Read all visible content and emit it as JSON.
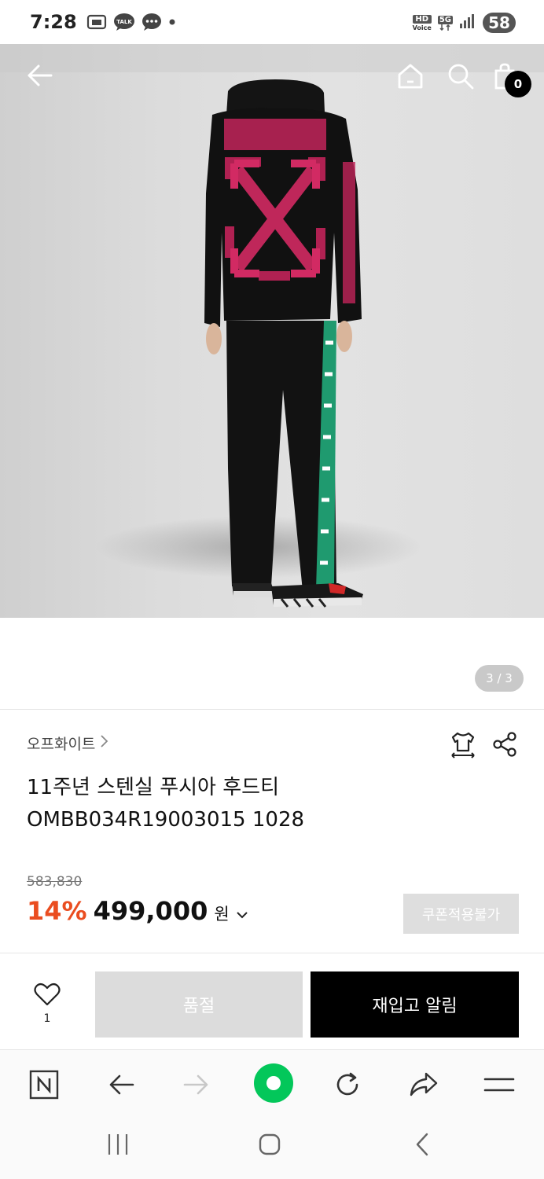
{
  "status_bar": {
    "time": "7:28",
    "hd_top": "HD",
    "hd_bottom": "Voice",
    "network": "5G",
    "battery": "58"
  },
  "header": {
    "cart_count": "0"
  },
  "gallery": {
    "counter": "3 / 3"
  },
  "product": {
    "brand": "오프화이트",
    "title_line1": "11주년 스텐실 푸시아 후드티",
    "title_line2": "OMBB034R19003015 1028",
    "original_price": "583,830",
    "discount": "14%",
    "price": "499,000",
    "currency": "원",
    "coupon_label": "쿠폰적용불가"
  },
  "actions": {
    "wish_count": "1",
    "soldout_label": "품절",
    "restock_label": "재입고 알림"
  },
  "colors": {
    "discount": "#ea4d20",
    "primary_button": "#000000",
    "disabled_button": "#dcdcdc",
    "browser_accent": "#03c75a"
  },
  "icons": {
    "back": "arrow-left-icon",
    "home": "home-icon",
    "search": "search-icon",
    "cart": "shopping-bag-icon",
    "size": "tshirt-size-icon",
    "share": "share-icon",
    "wish": "heart-icon"
  }
}
